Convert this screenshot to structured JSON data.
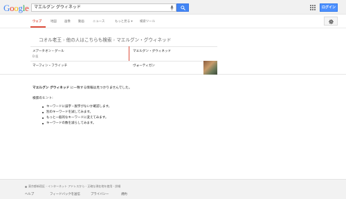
{
  "header": {
    "logo_letters": [
      {
        "char": "G",
        "color": "#4285f4"
      },
      {
        "char": "o",
        "color": "#ea4335"
      },
      {
        "char": "o",
        "color": "#fbbc05"
      },
      {
        "char": "g",
        "color": "#4285f4"
      },
      {
        "char": "l",
        "color": "#34a853"
      },
      {
        "char": "e",
        "color": "#ea4335"
      }
    ],
    "search_value": "マエルグン グウィネッド",
    "login_label": "ログイン"
  },
  "nav": {
    "items": [
      "ウェブ",
      "地図",
      "画像",
      "動画",
      "ニュース",
      "もっと見る ▾",
      "検索ツール"
    ],
    "active_index": 0
  },
  "knowledge": {
    "breadcrumb": [
      "コオル老王",
      "他の人はこちらも検索",
      "マエルグン・グウィネッド"
    ],
    "cards": [
      {
        "title": "メアーチオン・グール",
        "subtitle": "D 医"
      },
      {
        "title": "マエルグン・グウィネッド",
        "subtitle": ""
      },
      {
        "title": "マーフィン・フライッチ",
        "subtitle": ""
      },
      {
        "title": "ヴォーティガン",
        "subtitle": ""
      }
    ]
  },
  "results": {
    "no_match_bold": "マエルグン グウィネッド",
    "no_match_rest": " に一致する情報は見つかりませんでした。",
    "tips_heading": "検索のヒント:",
    "tips": [
      "キーワードに誤字・脱字がないか確認します。",
      "別のキーワードを試してみます。",
      "もっと一般的なキーワードに変えてみます。",
      "キーワードの数を減らしてみます。"
    ]
  },
  "footer": {
    "location": "東京都新宿区 - インターネット アドレスから - 正確な現在地を使用 - 詳細",
    "links": [
      "ヘルプ",
      "フィードバックを送信",
      "プライバシー",
      "規約"
    ]
  },
  "colors": {
    "accent_red": "#dd4b39",
    "search_blue": "#4285f4",
    "login_blue": "#4d90fe"
  }
}
